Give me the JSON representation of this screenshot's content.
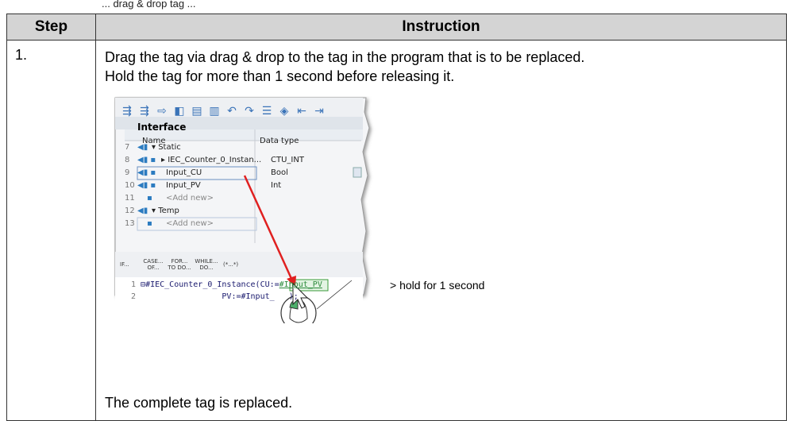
{
  "top_text": "... drag & drop tag ...",
  "table": {
    "headers": {
      "step": "Step",
      "instruction": "Instruction"
    },
    "rows": [
      {
        "step": "1.",
        "line1": "Drag the tag via drag & drop to the tag in the program that is to be replaced.",
        "line2": "Hold the tag for more than 1 second before releasing it.",
        "line3": "The complete tag is replaced."
      }
    ]
  },
  "screenshot": {
    "panel_title": "Interface",
    "columns": {
      "name": "Name",
      "data_type": "Data type"
    },
    "rows": [
      {
        "num": "7",
        "name": "▾ Static",
        "type": ""
      },
      {
        "num": "8",
        "name": "▸ IEC_Counter_0_Instan...",
        "type": "CTU_INT"
      },
      {
        "num": "9",
        "name": "Input_CU",
        "type": "Bool"
      },
      {
        "num": "10",
        "name": "Input_PV",
        "type": "Int"
      },
      {
        "num": "11",
        "name": "<Add new>",
        "type": ""
      },
      {
        "num": "12",
        "name": "▾ Temp",
        "type": ""
      },
      {
        "num": "13",
        "name": "<Add new>",
        "type": ""
      }
    ],
    "keywords": [
      "IF...",
      "CASE... OF...",
      "FOR... TO DO...",
      "WHILE... DO...",
      "(*...*)"
    ],
    "code": {
      "line1_num": "1",
      "line1": "#IEC_Counter_0_Instance(CU:=",
      "line1_hl": "#Input_PV",
      "line2_num": "2",
      "line2": "PV:=#Input_",
      "line2_tail": ");"
    },
    "annotation": "> hold for 1 second",
    "accent_color": "#e02020"
  }
}
